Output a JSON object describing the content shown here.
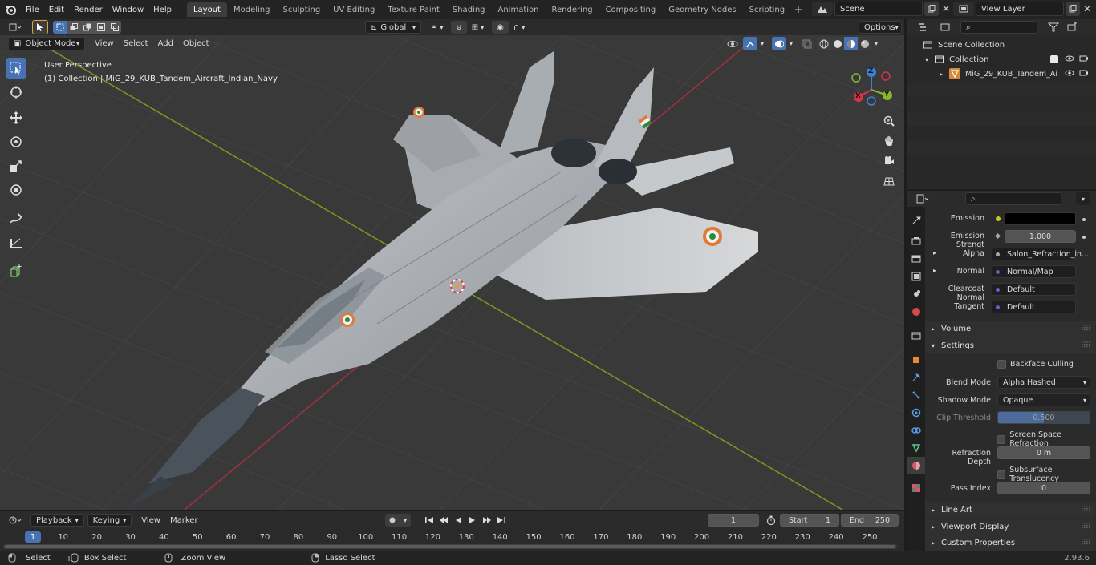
{
  "menu": [
    "File",
    "Edit",
    "Render",
    "Window",
    "Help"
  ],
  "workspaces": [
    "Layout",
    "Modeling",
    "Sculpting",
    "UV Editing",
    "Texture Paint",
    "Shading",
    "Animation",
    "Rendering",
    "Compositing",
    "Geometry Nodes",
    "Scripting"
  ],
  "active_workspace": "Layout",
  "scene_name": "Scene",
  "view_layer": "View Layer",
  "viewport": {
    "mode": "Object Mode",
    "menus": [
      "View",
      "Select",
      "Add",
      "Object"
    ],
    "transform_orientation": "Global",
    "options_label": "Options",
    "overlay_title": "User Perspective",
    "overlay_subtitle": "(1) Collection | MiG_29_KUB_Tandem_Aircraft_Indian_Navy",
    "gizmo_axes": {
      "x": "X",
      "y": "Y",
      "z": "Z"
    }
  },
  "outliner": {
    "scene_collection": "Scene Collection",
    "collection": "Collection",
    "object": "MiG_29_KUB_Tandem_Ai"
  },
  "properties": {
    "emission_label": "Emission",
    "emission_strength_label": "Emission Strengt",
    "emission_strength_value": "1.000",
    "alpha_label": "Alpha",
    "alpha_value": "Salon_Refraction_in...",
    "normal_label": "Normal",
    "normal_value": "Normal/Map",
    "clearcoat_label": "Clearcoat Normal",
    "clearcoat_value": "Default",
    "tangent_label": "Tangent",
    "tangent_value": "Default",
    "volume_section": "Volume",
    "settings_section": "Settings",
    "backface_culling": "Backface Culling",
    "blend_mode_label": "Blend Mode",
    "blend_mode_value": "Alpha Hashed",
    "shadow_mode_label": "Shadow Mode",
    "shadow_mode_value": "Opaque",
    "clip_threshold_label": "Clip Threshold",
    "clip_threshold_value": "0.500",
    "screen_space_refraction": "Screen Space Refraction",
    "refraction_depth_label": "Refraction Depth",
    "refraction_depth_value": "0 m",
    "subsurface_translucency": "Subsurface Translucency",
    "pass_index_label": "Pass Index",
    "pass_index_value": "0",
    "line_art_section": "Line Art",
    "viewport_display_section": "Viewport Display",
    "custom_properties_section": "Custom Properties"
  },
  "timeline": {
    "menus": [
      "Playback",
      "Keying",
      "View",
      "Marker"
    ],
    "current_frame": "1",
    "start_label": "Start",
    "start_value": "1",
    "end_label": "End",
    "end_value": "250",
    "ticks": [
      "1",
      "10",
      "20",
      "30",
      "40",
      "50",
      "60",
      "70",
      "80",
      "90",
      "100",
      "110",
      "120",
      "130",
      "140",
      "150",
      "160",
      "170",
      "180",
      "190",
      "200",
      "210",
      "220",
      "230",
      "240",
      "250"
    ]
  },
  "status": {
    "select": "Select",
    "box_select": "Box Select",
    "zoom_view": "Zoom View",
    "lasso_select": "Lasso Select",
    "version": "2.93.6"
  },
  "colors": {
    "accent": "#4772b3",
    "x_axis": "#d6334a",
    "y_axis": "#8ab62c",
    "z_axis": "#3c7fd8"
  }
}
